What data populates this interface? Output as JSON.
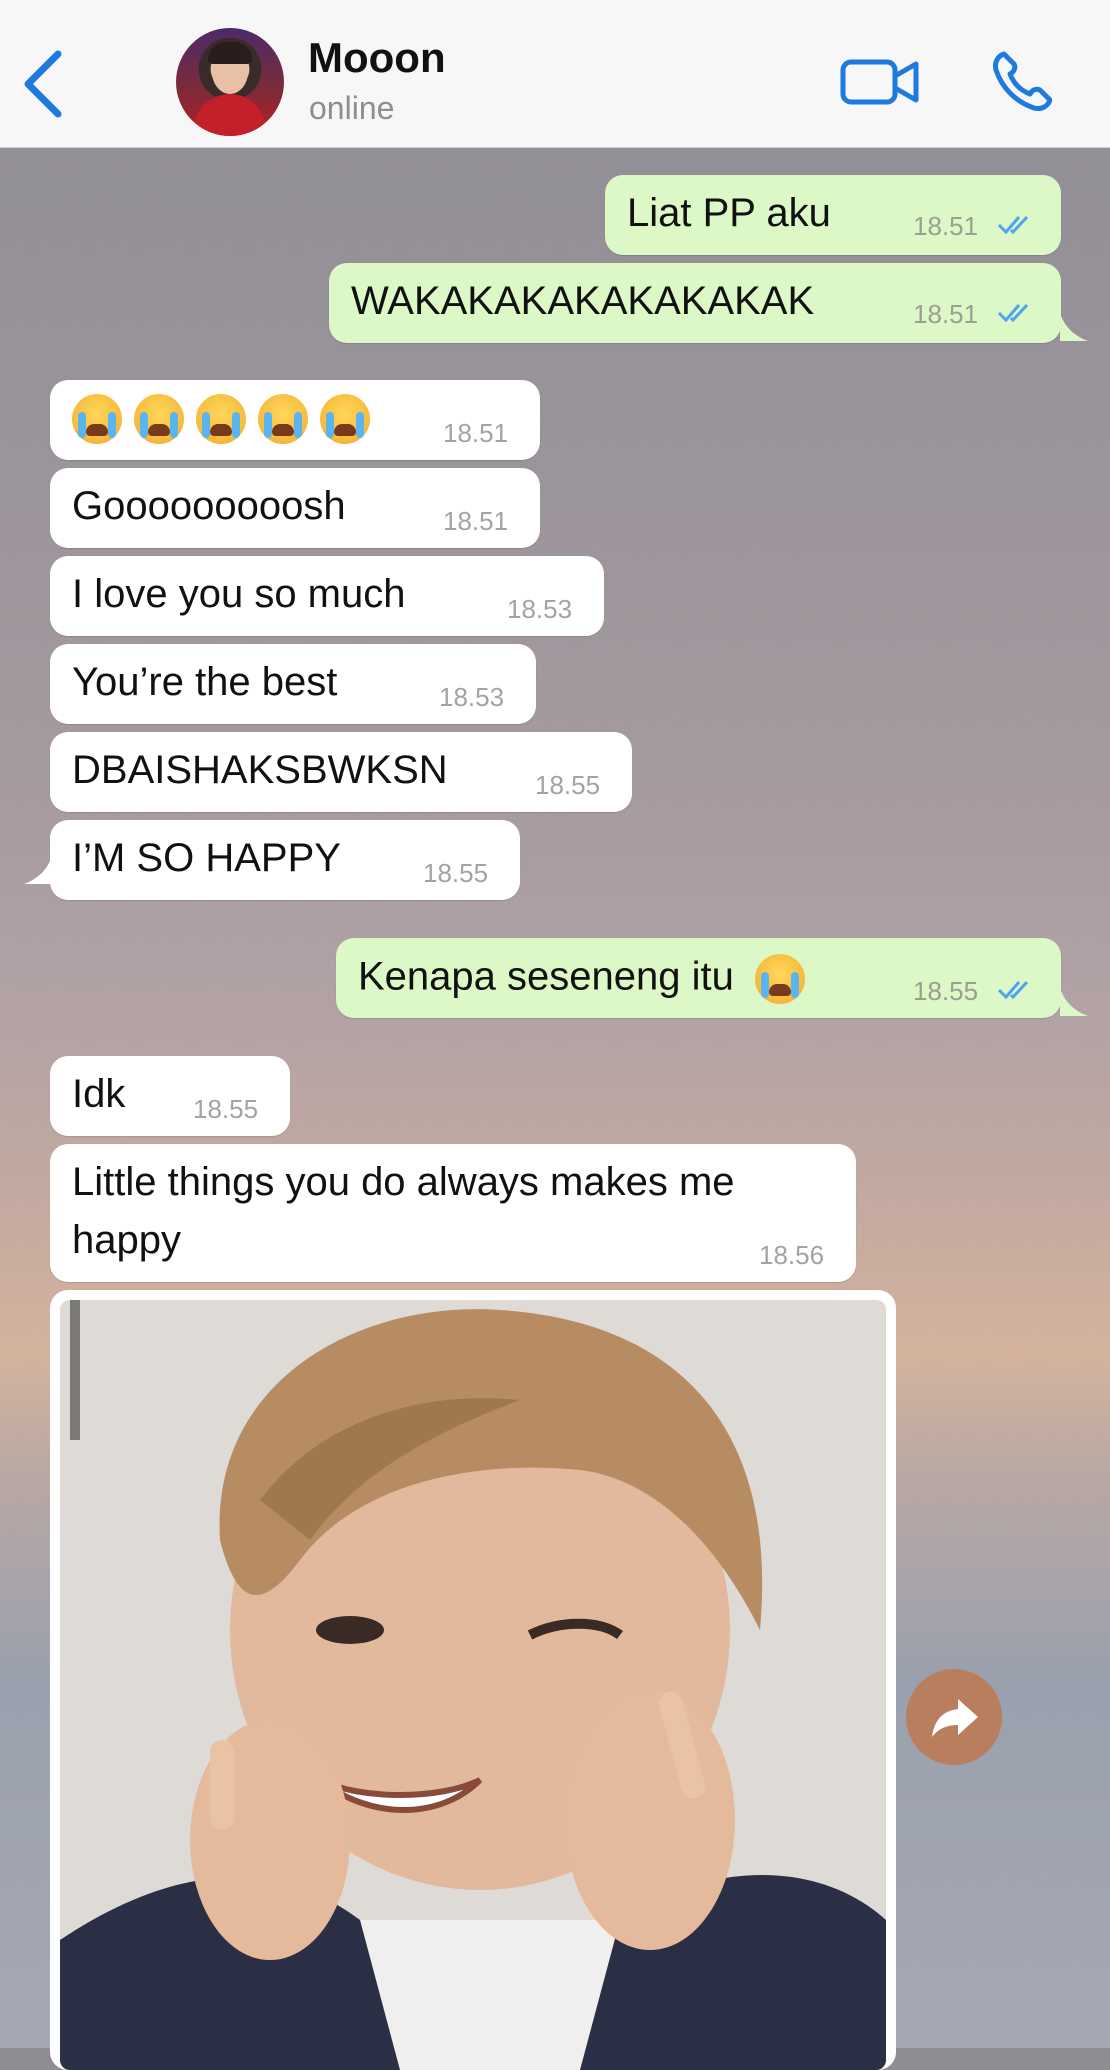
{
  "header": {
    "contact_name": "Mooon",
    "status": "online",
    "back_icon": "chevron-left-icon",
    "video_icon": "video-camera-icon",
    "call_icon": "phone-icon",
    "accent_color": "#1f7ae0"
  },
  "messages": [
    {
      "from": "me",
      "text": "Liat PP aku",
      "time": "18.51",
      "read": true
    },
    {
      "from": "me",
      "text": "WAKAKAKAKAKAKAKAK",
      "time": "18.51",
      "read": true
    },
    {
      "from": "them",
      "text": "😭😭😭😭😭",
      "time": "18.51"
    },
    {
      "from": "them",
      "text": "Gooooooooosh",
      "time": "18.51"
    },
    {
      "from": "them",
      "text": "I love you so much",
      "time": "18.53"
    },
    {
      "from": "them",
      "text": "You’re the best",
      "time": "18.53"
    },
    {
      "from": "them",
      "text": "DBAISHAKSBWKSN",
      "time": "18.55"
    },
    {
      "from": "them",
      "text": "I’M SO HAPPY",
      "time": "18.55"
    },
    {
      "from": "me",
      "text": "Kenapa seseneng itu",
      "time": "18.55",
      "read": true
    },
    {
      "from": "them",
      "text": "Idk",
      "time": "18.55"
    },
    {
      "from": "them",
      "text_line1": "Little things you do always makes me",
      "text_line2": "happy",
      "time": "18.56"
    },
    {
      "from": "them",
      "type": "image"
    }
  ],
  "colors": {
    "outgoing_bubble": "#dcf8c6",
    "incoming_bubble": "#ffffff",
    "read_ticks": "#4fa3ef"
  },
  "forward_icon": "forward-arrow-icon"
}
